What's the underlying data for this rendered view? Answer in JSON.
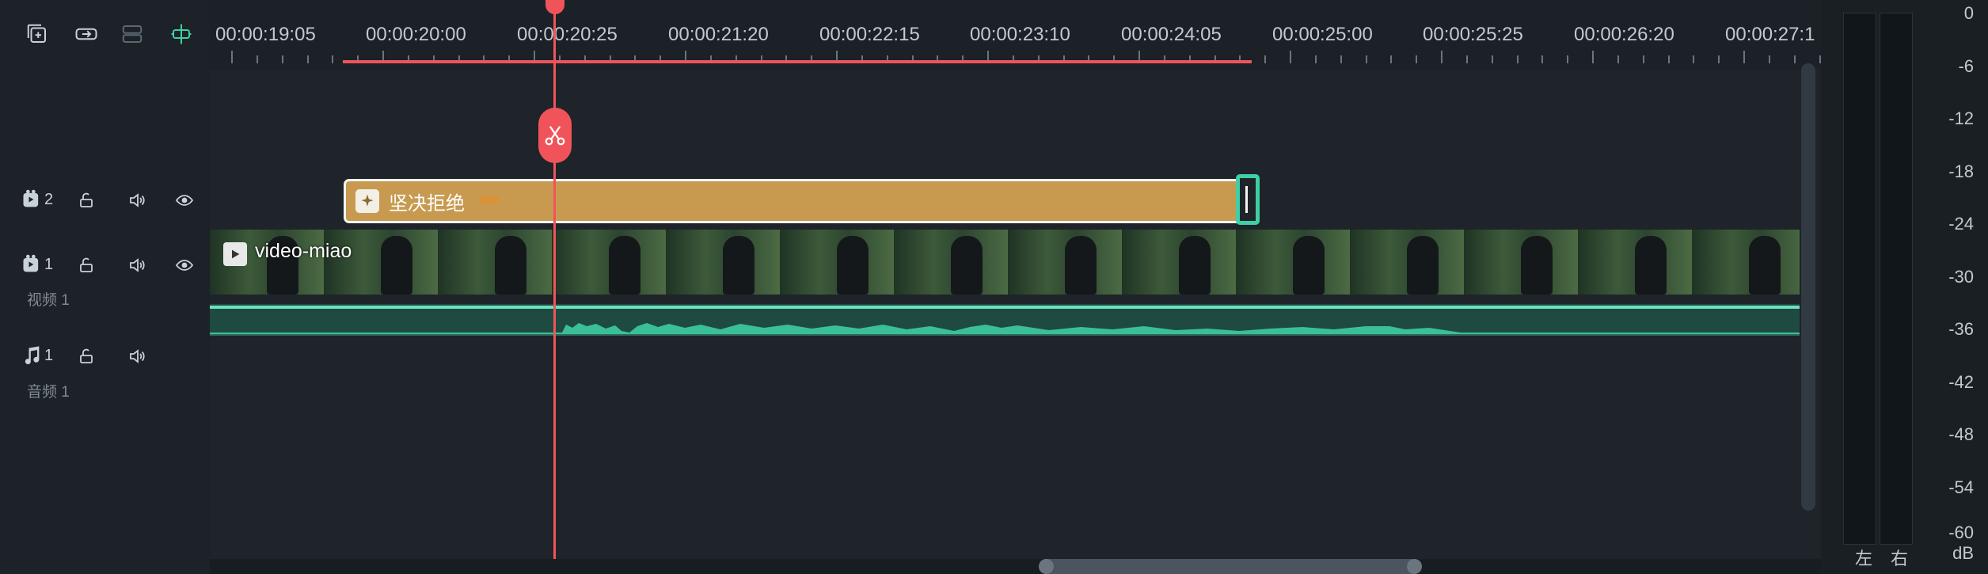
{
  "toolbar": {
    "icons": [
      "add-track-icon",
      "link-icon",
      "unlink-icon",
      "snap-icon"
    ]
  },
  "ruler": {
    "timecodes": [
      "00:00:19:05",
      "00:00:20:00",
      "00:00:20:25",
      "00:00:21:20",
      "00:00:22:15",
      "00:00:23:10",
      "00:00:24:05",
      "00:00:25:00",
      "00:00:25:25",
      "00:00:26:20",
      "00:00:27:1"
    ]
  },
  "tracks": {
    "track2": {
      "number": "2"
    },
    "track1": {
      "number": "1",
      "name": "视频 1"
    },
    "audio1": {
      "number": "1",
      "name": "音频 1"
    }
  },
  "clips": {
    "effect": {
      "label": "坚决拒绝",
      "badge": "VIP"
    },
    "video": {
      "label": "video-miao"
    }
  },
  "meter": {
    "scale": [
      "0",
      "-6",
      "-12",
      "-18",
      "-24",
      "-30",
      "-36",
      "-42",
      "-48",
      "-54",
      "-60"
    ],
    "unit": "dB",
    "left_label": "左",
    "right_label": "右"
  },
  "colors": {
    "playhead": "#f0545a",
    "effect_clip": "#c79a50",
    "audio_wave": "#3bbf9a",
    "accent_teal": "#3fcfa6"
  }
}
